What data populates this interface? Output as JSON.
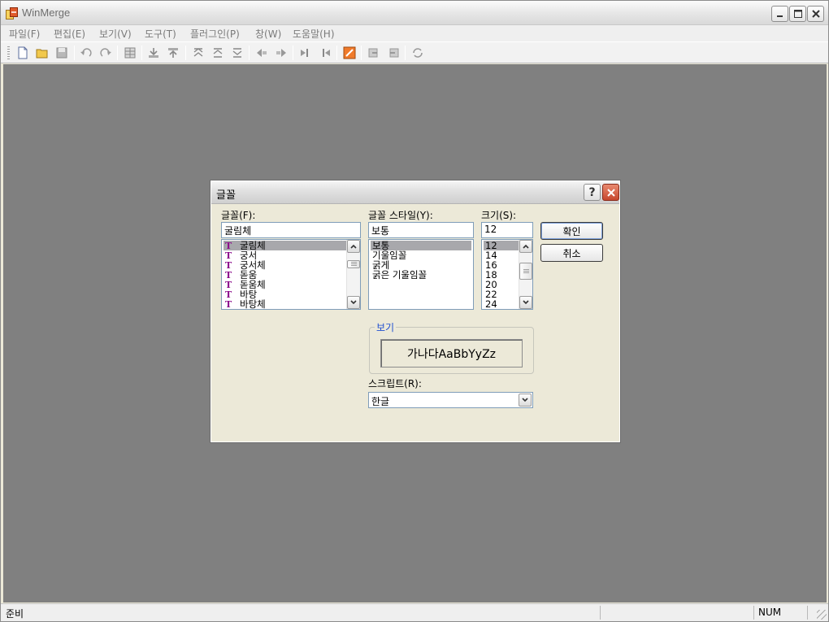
{
  "window": {
    "title": "WinMerge"
  },
  "menu": [
    "파일(F)",
    "편집(E)",
    "보기(V)",
    "도구(T)",
    "플러그인(P)",
    "창(W)",
    "도움말(H)"
  ],
  "toolbar": {
    "buttons": [
      "new-file-icon",
      "open-folder-icon",
      "save-icon",
      "undo-icon",
      "redo-icon",
      "diff-pane-icon",
      "copy-to-left-icon",
      "copy-to-right-icon",
      "first-diff-icon",
      "prev-diff-icon",
      "next-diff-icon",
      "move-left-icon",
      "move-right-icon",
      "merge-left-icon",
      "merge-right-icon",
      "options-icon",
      "compare-left-icon",
      "compare-right-icon",
      "refresh-icon"
    ]
  },
  "dialog": {
    "title": "글꼴",
    "help_symbol": "?",
    "font_label": "글꼴(F):",
    "font_value": "굴림체",
    "fonts": [
      "굴림체",
      "궁서",
      "궁서체",
      "돋움",
      "돋움체",
      "바탕",
      "바탕체"
    ],
    "style_label": "글꼴 스타일(Y):",
    "style_value": "보통",
    "styles": [
      "보통",
      "기울임꼴",
      "굵게",
      "굵은 기울임꼴"
    ],
    "size_label": "크기(S):",
    "size_value": "12",
    "sizes": [
      "12",
      "14",
      "16",
      "18",
      "20",
      "22",
      "24"
    ],
    "ok_label": "확인",
    "cancel_label": "취소",
    "sample_label": "보기",
    "sample_text": "가나다AaBbYyZz",
    "script_label": "스크립트(R):",
    "script_value": "한글",
    "font_glyph": "T"
  },
  "status": {
    "text": "준비",
    "num": "NUM"
  }
}
